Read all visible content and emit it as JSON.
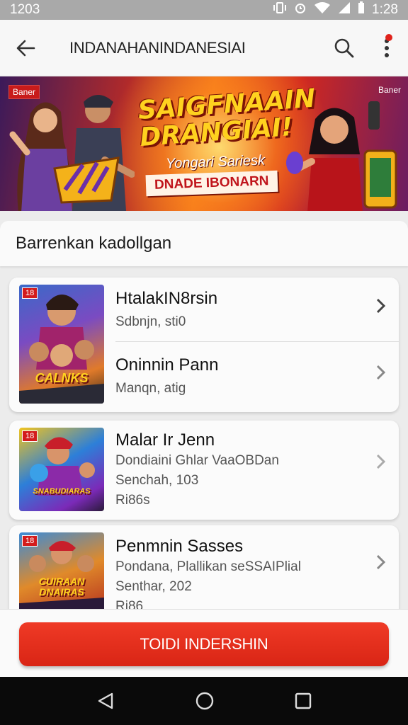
{
  "status_bar": {
    "time_left": "1203",
    "time_right": "1:28",
    "icons": [
      "vibrate-icon",
      "alarm-icon",
      "wifi-icon",
      "signal-icon",
      "battery-icon"
    ]
  },
  "app_bar": {
    "title": "INDANAHANINDANESIAI",
    "back_icon": "back-arrow-icon",
    "search_icon": "search-icon",
    "menu_icon": "more-vert-icon"
  },
  "banner": {
    "tag_left": "Baner",
    "tag_right": "Baner",
    "title": "SAIGFNAAIN DRANGIAI!",
    "subtitle": "Yongari Sariesk",
    "strip": "DNADE IBONARN"
  },
  "section": {
    "title": "Barrenkan kadollgan"
  },
  "games": [
    {
      "badge": "18",
      "art_word": "CALNKS",
      "entries": [
        {
          "title": "HtalakIN8rsin",
          "meta": "Sdbnjn, sti0"
        },
        {
          "title": "Oninnin Pann",
          "meta": "Manqn, atig"
        }
      ]
    },
    {
      "badge": "18",
      "art_word": "SNABUDIARAS",
      "title": "Malar Ir Jenn",
      "lines": [
        "Dondiaini Ghlar VaaOBDan",
        "Senchah, 103",
        "Ri86s"
      ]
    },
    {
      "badge": "18",
      "art_word": "CUIRAAN DNAIRAS",
      "title": "Penmnin Sasses",
      "lines": [
        "Pondana, Plallikan seSSAIPlial",
        "Senthar, 202",
        "Ri86"
      ]
    }
  ],
  "cta": {
    "label": "TOIDI INDERSHIN"
  },
  "nav": {
    "back_icon": "nav-back-icon",
    "home_icon": "nav-home-icon",
    "recents_icon": "nav-recents-icon"
  },
  "colors": {
    "accent": "#e3281a",
    "nav": "#0a0a0a",
    "status": "#a9a9a9"
  }
}
